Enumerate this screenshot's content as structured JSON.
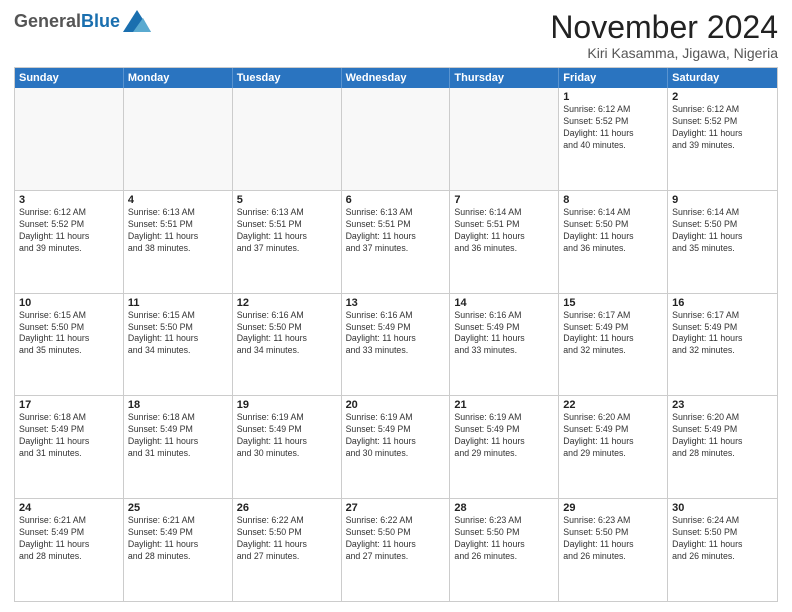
{
  "logo": {
    "general": "General",
    "blue": "Blue"
  },
  "title": "November 2024",
  "subtitle": "Kiri Kasamma, Jigawa, Nigeria",
  "weekdays": [
    "Sunday",
    "Monday",
    "Tuesday",
    "Wednesday",
    "Thursday",
    "Friday",
    "Saturday"
  ],
  "weeks": [
    [
      {
        "day": "",
        "lines": []
      },
      {
        "day": "",
        "lines": []
      },
      {
        "day": "",
        "lines": []
      },
      {
        "day": "",
        "lines": []
      },
      {
        "day": "",
        "lines": []
      },
      {
        "day": "1",
        "lines": [
          "Sunrise: 6:12 AM",
          "Sunset: 5:52 PM",
          "Daylight: 11 hours",
          "and 40 minutes."
        ]
      },
      {
        "day": "2",
        "lines": [
          "Sunrise: 6:12 AM",
          "Sunset: 5:52 PM",
          "Daylight: 11 hours",
          "and 39 minutes."
        ]
      }
    ],
    [
      {
        "day": "3",
        "lines": [
          "Sunrise: 6:12 AM",
          "Sunset: 5:52 PM",
          "Daylight: 11 hours",
          "and 39 minutes."
        ]
      },
      {
        "day": "4",
        "lines": [
          "Sunrise: 6:13 AM",
          "Sunset: 5:51 PM",
          "Daylight: 11 hours",
          "and 38 minutes."
        ]
      },
      {
        "day": "5",
        "lines": [
          "Sunrise: 6:13 AM",
          "Sunset: 5:51 PM",
          "Daylight: 11 hours",
          "and 37 minutes."
        ]
      },
      {
        "day": "6",
        "lines": [
          "Sunrise: 6:13 AM",
          "Sunset: 5:51 PM",
          "Daylight: 11 hours",
          "and 37 minutes."
        ]
      },
      {
        "day": "7",
        "lines": [
          "Sunrise: 6:14 AM",
          "Sunset: 5:51 PM",
          "Daylight: 11 hours",
          "and 36 minutes."
        ]
      },
      {
        "day": "8",
        "lines": [
          "Sunrise: 6:14 AM",
          "Sunset: 5:50 PM",
          "Daylight: 11 hours",
          "and 36 minutes."
        ]
      },
      {
        "day": "9",
        "lines": [
          "Sunrise: 6:14 AM",
          "Sunset: 5:50 PM",
          "Daylight: 11 hours",
          "and 35 minutes."
        ]
      }
    ],
    [
      {
        "day": "10",
        "lines": [
          "Sunrise: 6:15 AM",
          "Sunset: 5:50 PM",
          "Daylight: 11 hours",
          "and 35 minutes."
        ]
      },
      {
        "day": "11",
        "lines": [
          "Sunrise: 6:15 AM",
          "Sunset: 5:50 PM",
          "Daylight: 11 hours",
          "and 34 minutes."
        ]
      },
      {
        "day": "12",
        "lines": [
          "Sunrise: 6:16 AM",
          "Sunset: 5:50 PM",
          "Daylight: 11 hours",
          "and 34 minutes."
        ]
      },
      {
        "day": "13",
        "lines": [
          "Sunrise: 6:16 AM",
          "Sunset: 5:49 PM",
          "Daylight: 11 hours",
          "and 33 minutes."
        ]
      },
      {
        "day": "14",
        "lines": [
          "Sunrise: 6:16 AM",
          "Sunset: 5:49 PM",
          "Daylight: 11 hours",
          "and 33 minutes."
        ]
      },
      {
        "day": "15",
        "lines": [
          "Sunrise: 6:17 AM",
          "Sunset: 5:49 PM",
          "Daylight: 11 hours",
          "and 32 minutes."
        ]
      },
      {
        "day": "16",
        "lines": [
          "Sunrise: 6:17 AM",
          "Sunset: 5:49 PM",
          "Daylight: 11 hours",
          "and 32 minutes."
        ]
      }
    ],
    [
      {
        "day": "17",
        "lines": [
          "Sunrise: 6:18 AM",
          "Sunset: 5:49 PM",
          "Daylight: 11 hours",
          "and 31 minutes."
        ]
      },
      {
        "day": "18",
        "lines": [
          "Sunrise: 6:18 AM",
          "Sunset: 5:49 PM",
          "Daylight: 11 hours",
          "and 31 minutes."
        ]
      },
      {
        "day": "19",
        "lines": [
          "Sunrise: 6:19 AM",
          "Sunset: 5:49 PM",
          "Daylight: 11 hours",
          "and 30 minutes."
        ]
      },
      {
        "day": "20",
        "lines": [
          "Sunrise: 6:19 AM",
          "Sunset: 5:49 PM",
          "Daylight: 11 hours",
          "and 30 minutes."
        ]
      },
      {
        "day": "21",
        "lines": [
          "Sunrise: 6:19 AM",
          "Sunset: 5:49 PM",
          "Daylight: 11 hours",
          "and 29 minutes."
        ]
      },
      {
        "day": "22",
        "lines": [
          "Sunrise: 6:20 AM",
          "Sunset: 5:49 PM",
          "Daylight: 11 hours",
          "and 29 minutes."
        ]
      },
      {
        "day": "23",
        "lines": [
          "Sunrise: 6:20 AM",
          "Sunset: 5:49 PM",
          "Daylight: 11 hours",
          "and 28 minutes."
        ]
      }
    ],
    [
      {
        "day": "24",
        "lines": [
          "Sunrise: 6:21 AM",
          "Sunset: 5:49 PM",
          "Daylight: 11 hours",
          "and 28 minutes."
        ]
      },
      {
        "day": "25",
        "lines": [
          "Sunrise: 6:21 AM",
          "Sunset: 5:49 PM",
          "Daylight: 11 hours",
          "and 28 minutes."
        ]
      },
      {
        "day": "26",
        "lines": [
          "Sunrise: 6:22 AM",
          "Sunset: 5:50 PM",
          "Daylight: 11 hours",
          "and 27 minutes."
        ]
      },
      {
        "day": "27",
        "lines": [
          "Sunrise: 6:22 AM",
          "Sunset: 5:50 PM",
          "Daylight: 11 hours",
          "and 27 minutes."
        ]
      },
      {
        "day": "28",
        "lines": [
          "Sunrise: 6:23 AM",
          "Sunset: 5:50 PM",
          "Daylight: 11 hours",
          "and 26 minutes."
        ]
      },
      {
        "day": "29",
        "lines": [
          "Sunrise: 6:23 AM",
          "Sunset: 5:50 PM",
          "Daylight: 11 hours",
          "and 26 minutes."
        ]
      },
      {
        "day": "30",
        "lines": [
          "Sunrise: 6:24 AM",
          "Sunset: 5:50 PM",
          "Daylight: 11 hours",
          "and 26 minutes."
        ]
      }
    ]
  ]
}
